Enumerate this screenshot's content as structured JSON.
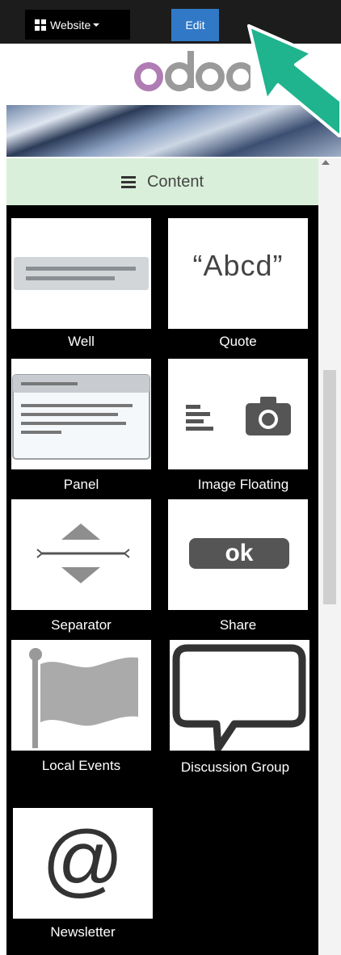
{
  "toolbar": {
    "website_label": "Website",
    "edit_label": "Edit"
  },
  "brand": {
    "logo_text": "odoo",
    "logo_colors": [
      "#b07cb4",
      "#9a9a9a",
      "#9a9a9a",
      "#9a9a9a"
    ]
  },
  "sidebar": {
    "header_label": "Content",
    "header_icon": "menu-icon",
    "snippets": [
      {
        "label": "Well",
        "icon": "well-icon"
      },
      {
        "label": "Quote",
        "icon": "quote-icon",
        "text": "“Abcd”"
      },
      {
        "label": "Panel",
        "icon": "panel-icon"
      },
      {
        "label": "Image Floating",
        "icon": "image-floating-icon"
      },
      {
        "label": "Separator",
        "icon": "separator-icon"
      },
      {
        "label": "Share",
        "icon": "share-icon",
        "text": "ok"
      },
      {
        "label": "Local Events",
        "icon": "flag-icon"
      },
      {
        "label": "Discussion Group",
        "icon": "speech-bubble-icon"
      },
      {
        "label": "Newsletter",
        "icon": "at-sign-icon",
        "text": "@"
      }
    ]
  },
  "colors": {
    "topbar": "#1c1c1c",
    "edit_button": "#3179c6",
    "content_header": "#d9efd9",
    "annotation_arrow": "#1fb38e"
  }
}
